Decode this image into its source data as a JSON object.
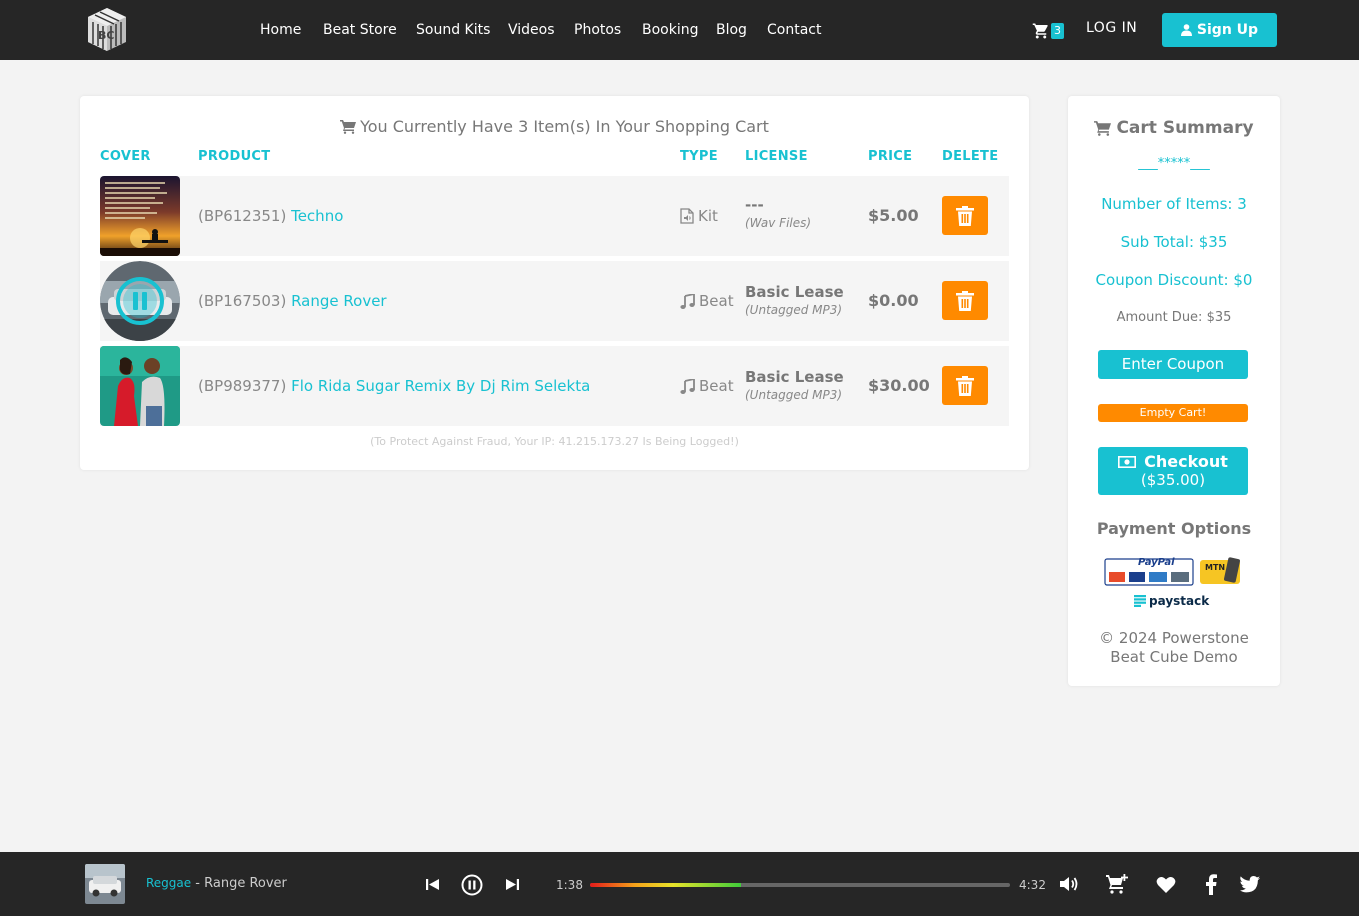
{
  "nav": {
    "links": [
      "Home",
      "Beat Store",
      "Sound Kits",
      "Videos",
      "Photos",
      "Booking",
      "Blog",
      "Contact"
    ],
    "cart_count": "3",
    "login": "LOG IN",
    "signup": "Sign Up"
  },
  "cart": {
    "title": "You Currently Have 3 Item(s) In Your Shopping Cart",
    "columns": {
      "cover": "COVER",
      "product": "PRODUCT",
      "type": "TYPE",
      "license": "LICENSE",
      "price": "PRICE",
      "delete": "DELETE"
    },
    "items": [
      {
        "code": "(BP612351)",
        "name": "Techno",
        "type": "Kit",
        "license": "---",
        "license_sub": "(Wav Files)",
        "price": "$5.00"
      },
      {
        "code": "(BP167503)",
        "name": "Range Rover",
        "type": "Beat",
        "license": "Basic Lease",
        "license_sub": "(Untagged MP3)",
        "price": "$0.00"
      },
      {
        "code": "(BP989377)",
        "name": "Flo Rida Sugar Remix By Dj Rim Selekta",
        "type": "Beat",
        "license": "Basic Lease",
        "license_sub": "(Untagged MP3)",
        "price": "$30.00"
      }
    ],
    "fraud_notice": "(To Protect Against Fraud, Your IP: 41.215.173.27 Is Being Logged!)"
  },
  "summary": {
    "title": "Cart Summary",
    "divider": "___*****___",
    "items_count": "Number of Items: 3",
    "subtotal": "Sub Total: $35",
    "coupon_discount": "Coupon Discount: $0",
    "amount_due": "Amount Due: $35",
    "enter_coupon": "Enter Coupon",
    "empty_cart": "Empty Cart!",
    "checkout": "Checkout",
    "checkout_total": "($35.00)",
    "payment_options": "Payment Options",
    "paypal_label": "PayPal",
    "mtn_label": "MTN",
    "paystack_label": "paystack",
    "copyright": "© 2024 Powerstone Beat Cube Demo"
  },
  "player": {
    "genre": "Reggae",
    "separator": " - ",
    "track": "Range Rover",
    "elapsed": "1:38",
    "duration": "4:32",
    "progress_percent": 36
  },
  "colors": {
    "accent": "#18c1d1",
    "orange": "#ff8a00",
    "dark": "#262626"
  },
  "icons": [
    "cart-icon",
    "user-icon",
    "trash-icon",
    "file-audio-icon",
    "music-note-icon",
    "money-icon",
    "skip-back-icon",
    "pause-icon",
    "skip-forward-icon",
    "volume-icon",
    "add-to-cart-icon",
    "heart-icon",
    "facebook-icon",
    "twitter-icon"
  ]
}
